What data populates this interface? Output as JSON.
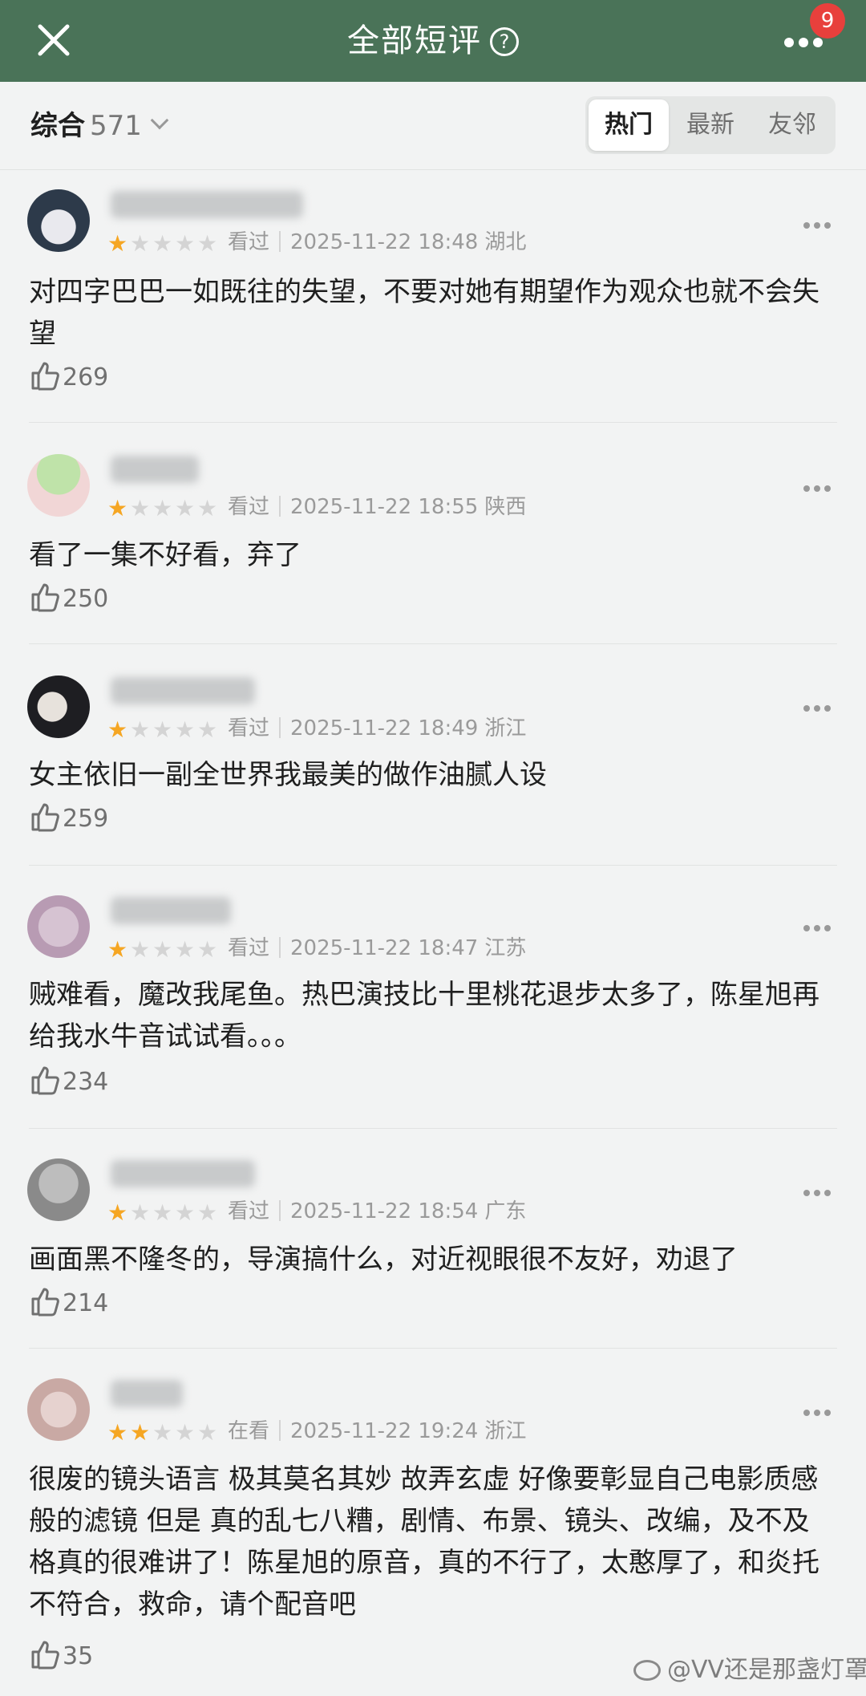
{
  "header": {
    "close_icon": "close-icon",
    "title": "全部短评",
    "help_glyph": "?",
    "more_icon": "more-dots-icon",
    "badge_count": "9"
  },
  "filter": {
    "sort_label": "综合",
    "sort_count": "571",
    "tabs": [
      {
        "label": "热门",
        "active": true
      },
      {
        "label": "最新",
        "active": false
      },
      {
        "label": "友邻",
        "active": false
      }
    ]
  },
  "reviews": [
    {
      "stars": 1,
      "status": "看过",
      "date": "2025-11-22 18:48",
      "location": "湖北",
      "text": "对四字巴巴一如既往的失望，不要对她有期望作为观众也就不会失望",
      "likes": "269"
    },
    {
      "stars": 1,
      "status": "看过",
      "date": "2025-11-22 18:55",
      "location": "陕西",
      "text": "看了一集不好看，弃了",
      "likes": "250"
    },
    {
      "stars": 1,
      "status": "看过",
      "date": "2025-11-22 18:49",
      "location": "浙江",
      "text": "女主依旧一副全世界我最美的做作油腻人设",
      "likes": "259"
    },
    {
      "stars": 1,
      "status": "看过",
      "date": "2025-11-22 18:47",
      "location": "江苏",
      "text": "贼难看，魔改我尾鱼。热巴演技比十里桃花退步太多了，陈星旭再给我水牛音试试看。。。",
      "likes": "234"
    },
    {
      "stars": 1,
      "status": "看过",
      "date": "2025-11-22 18:54",
      "location": "广东",
      "text": "画面黑不隆冬的，导演搞什么，对近视眼很不友好，劝退了",
      "likes": "214"
    },
    {
      "stars": 2,
      "status": "在看",
      "date": "2025-11-22 19:24",
      "location": "浙江",
      "text": "很废的镜头语言 极其莫名其妙 故弄玄虚 好像要彰显自己电影质感般的滤镜 但是 真的乱七八糟，剧情、布景、镜头、改编，及不及格真的很难讲了！陈星旭的原音，真的不行了，太憨厚了，和炎托不符合，救命，请个配音吧",
      "likes": "35"
    }
  ],
  "watermark": "@VV还是那盏灯罩",
  "colors": {
    "header_bg": "#4a7358",
    "star_on": "#f5a623",
    "badge": "#e8403c"
  }
}
